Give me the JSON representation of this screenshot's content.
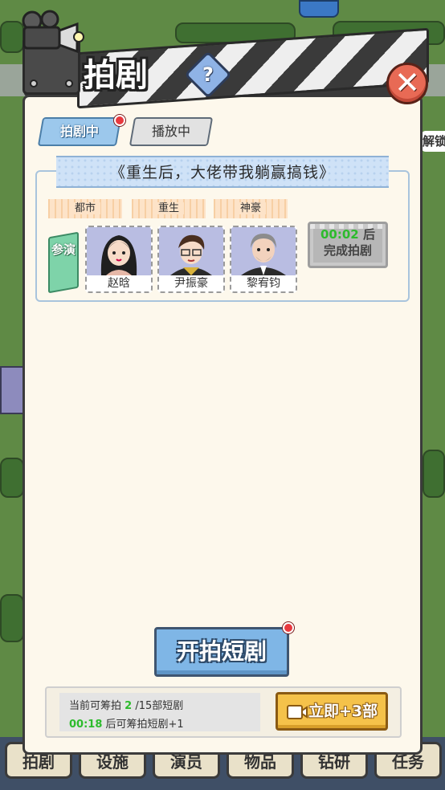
{
  "header": {
    "title": "拍剧",
    "help_label": "?",
    "close_label": "✕"
  },
  "tabs": [
    {
      "label": "拍剧中",
      "active": true,
      "has_badge": true
    },
    {
      "label": "播放中",
      "active": false,
      "has_badge": false
    }
  ],
  "drama": {
    "title": "《重生后，大佬带我躺赢搞钱》",
    "genres": [
      "都市",
      "重生",
      "神豪"
    ],
    "cast_label": "参演",
    "actors": [
      {
        "name": "赵晗",
        "portrait": "female-actor-portrait"
      },
      {
        "name": "尹振豪",
        "portrait": "male-actor-glasses-portrait"
      },
      {
        "name": "黎宥钧",
        "portrait": "older-male-actor-portrait"
      }
    ],
    "timer": {
      "time": "00:02",
      "suffix": "后",
      "line2": "完成拍剧"
    }
  },
  "start_button": {
    "label": "开拍短剧",
    "has_badge": true
  },
  "footer": {
    "line1_prefix": "当前可筹拍",
    "line1_count": "2",
    "line1_suffix": "/15部短剧",
    "line2_time": "00:18",
    "line2_suffix": "后可筹拍短剧+1",
    "boost_label": "立即+3部",
    "boost_icon": "video-ad-icon"
  },
  "background": {
    "side_text": "解锁",
    "nav_items": [
      "拍剧",
      "设施",
      "演员",
      "物品",
      "钻研",
      "任务"
    ]
  },
  "colors": {
    "accent_blue": "#7fb6e6",
    "timer_green": "#2dbb2d",
    "close_red": "#e86a55",
    "boost_gold": "#f5c24a",
    "badge_red": "#e8393e"
  }
}
